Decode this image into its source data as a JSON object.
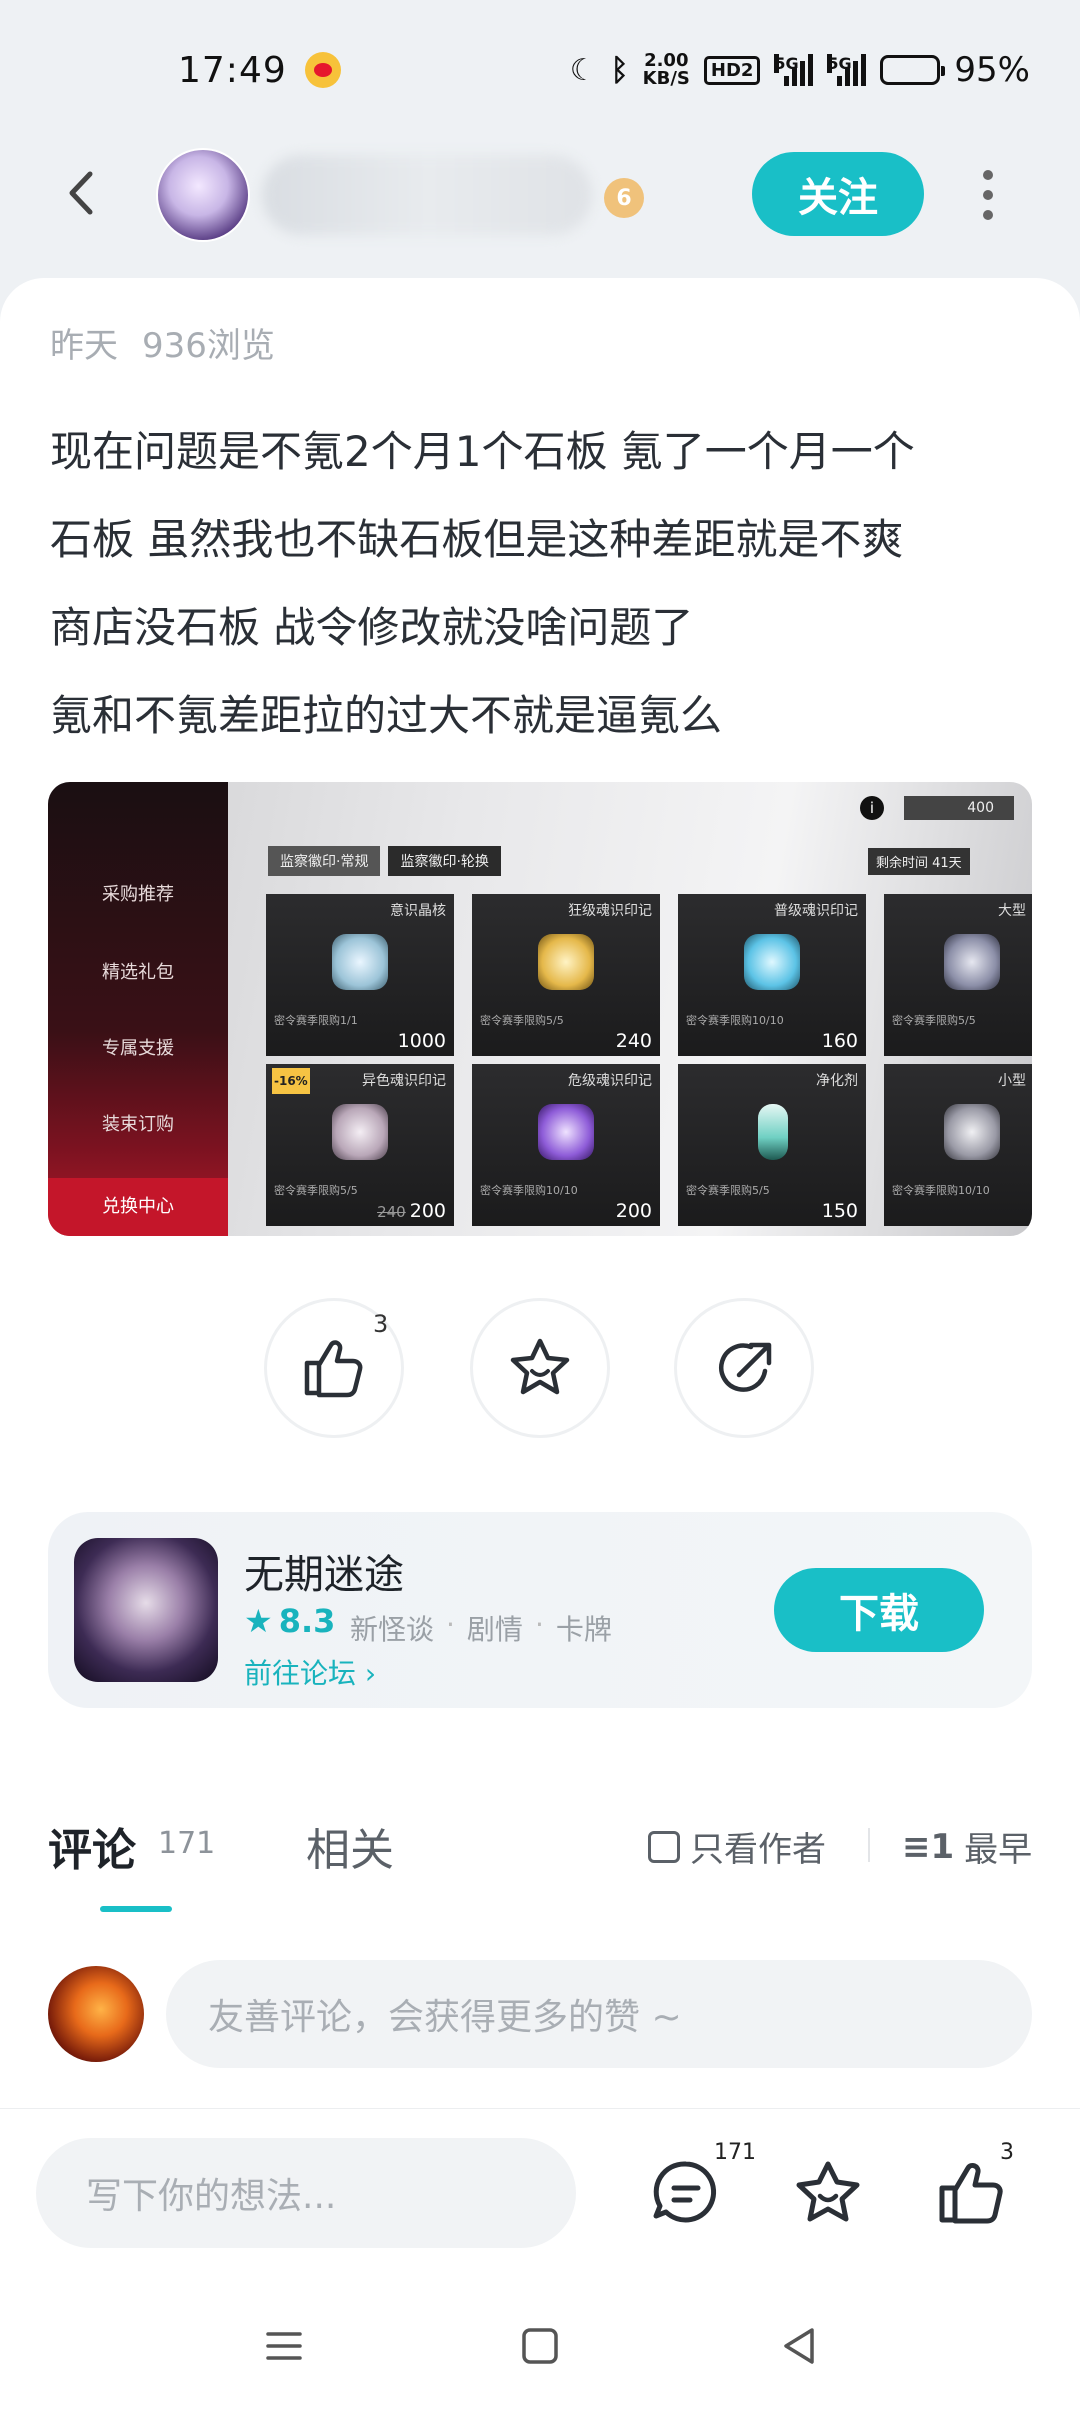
{
  "status_bar": {
    "time": "17:49",
    "net_speed_value": "2.00",
    "net_speed_unit": "KB/S",
    "hd": "HD2",
    "sig1_tag": "5G",
    "sig2_tag": "5G",
    "battery": "95%"
  },
  "header": {
    "follow_label": "关注",
    "level": "6"
  },
  "post": {
    "date": "昨天",
    "views": "936浏览",
    "lines": [
      "现在问题是不氪2个月1个石板 氪了一个月一个",
      "石板 虽然我也不缺石板但是这种差距就是不爽",
      "商店没石板  战令修改就没啥问题了",
      "氪和不氪差距拉的过大不就是逼氪么"
    ]
  },
  "image": {
    "coins": "400",
    "tabs": [
      "监察徽印·常规",
      "监察徽印·轮换"
    ],
    "timer": "剩余时间  41天",
    "sidebar": [
      "采购推荐",
      "精选礼包",
      "专属支援",
      "装束订购",
      "兑换中心"
    ],
    "items": [
      {
        "name": "意识晶核",
        "limit": "密令赛季限购1/1",
        "price": "1000",
        "old_price": "",
        "gem": "#9cc4d8"
      },
      {
        "name": "狂级魂识印记",
        "limit": "密令赛季限购5/5",
        "price": "240",
        "old_price": "",
        "gem": "#e5b84a"
      },
      {
        "name": "普级魂识印记",
        "limit": "密令赛季限购10/10",
        "price": "160",
        "old_price": "",
        "gem": "#5cc3e6"
      },
      {
        "name": "大型",
        "limit": "密令赛季限购5/5",
        "price": "",
        "old_price": "",
        "gem": "#8c8fa8"
      },
      {
        "name": "异色魂识印记",
        "limit": "密令赛季限购5/5",
        "price": "200",
        "old_price": "240",
        "gem": "#b9a7b8",
        "discount": "-16%"
      },
      {
        "name": "危级魂识印记",
        "limit": "密令赛季限购10/10",
        "price": "200",
        "old_price": "",
        "gem": "#8e5cd8"
      },
      {
        "name": "净化剂",
        "limit": "密令赛季限购5/5",
        "price": "150",
        "old_price": "",
        "gem": "#6fd0c3"
      },
      {
        "name": "小型",
        "limit": "密令赛季限购10/10",
        "price": "",
        "old_price": "",
        "gem": "#9a9aa6"
      }
    ]
  },
  "actions": {
    "like_count": "3"
  },
  "game": {
    "title": "无期迷途",
    "rating": "8.3",
    "tags": [
      "新怪谈",
      "剧情",
      "卡牌"
    ],
    "forum_link": "前往论坛",
    "download_label": "下载"
  },
  "comments": {
    "tab_comment": "评论",
    "count": "171",
    "tab_related": "相关",
    "author_only": "只看作者",
    "sort": "最早",
    "input_placeholder": "友善评论，会获得更多的赞 ~"
  },
  "bottom_bar": {
    "input_placeholder": "写下你的想法...",
    "comment_count": "171",
    "like_count": "3"
  },
  "colors": {
    "accent": "#19bfc7"
  }
}
